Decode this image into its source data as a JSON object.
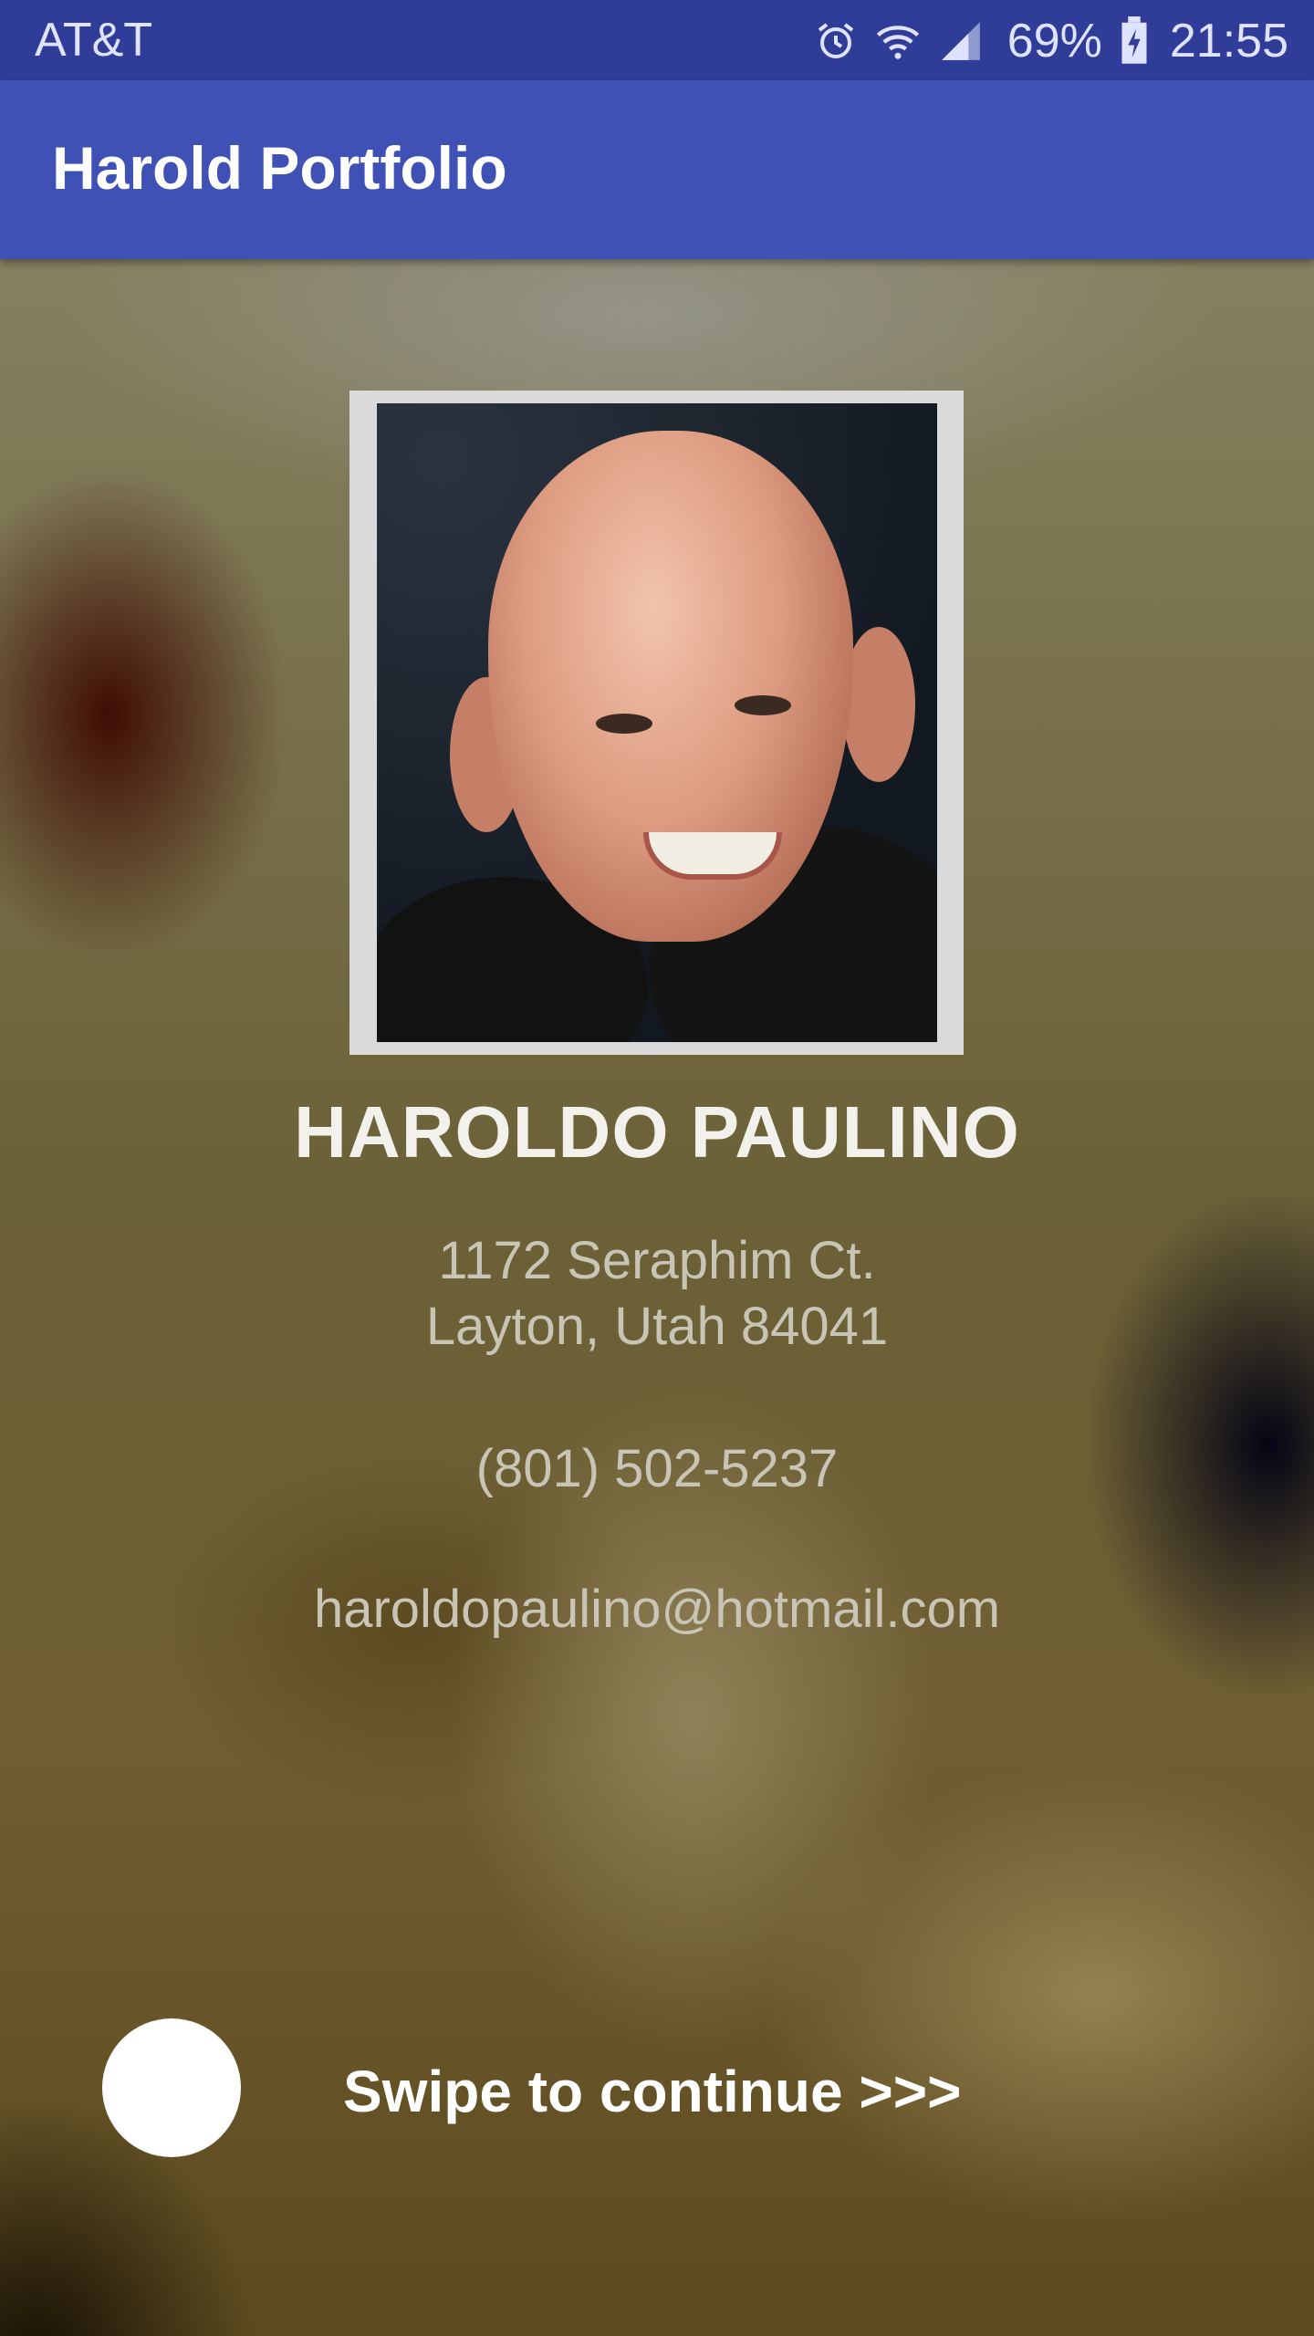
{
  "status_bar": {
    "carrier": "AT&T",
    "battery_percent": "69%",
    "time": "21:55",
    "icons": [
      "alarm-icon",
      "wifi-icon",
      "signal-icon",
      "battery-charging-icon"
    ]
  },
  "app_bar": {
    "title": "Harold Portfolio",
    "color": "#3f51b5"
  },
  "profile": {
    "name": "HAROLDO PAULINO",
    "address_line1": "1172 Seraphim Ct.",
    "address_line2": "Layton, Utah 84041",
    "phone": "(801) 502-5237",
    "email": "haroldopaulino@hotmail.com"
  },
  "swipe": {
    "label": "Swipe to continue >>>"
  }
}
